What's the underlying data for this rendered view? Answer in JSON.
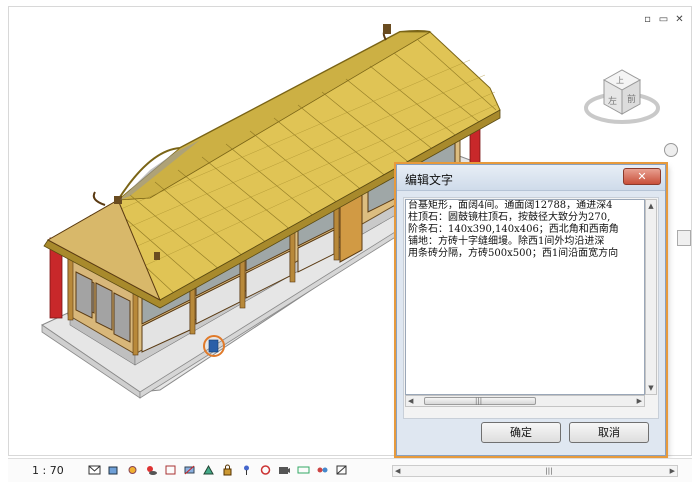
{
  "window_controls": {
    "minimize": "▫",
    "restore": "▭",
    "close": "✕"
  },
  "viewcube": {
    "top_face": "上",
    "left_face": "左",
    "right_face": "前"
  },
  "dialog": {
    "title": "编辑文字",
    "close_label": "✕",
    "text_lines": [
      "台基矩形，面阔4间。通面阔12788，通进深4",
      "柱顶石：圆鼓镜柱顶石，按鼓径大致分为270,",
      "阶条石：140x390,140x406；西北角和西南角",
      "铺地：方砖十字缝细墁。除西1间外均沿进深",
      "用条砖分隔，方砖500x500；西1间沿面宽方向"
    ],
    "ok_label": "确定",
    "cancel_label": "取消"
  },
  "bottom_bar": {
    "scale": "1 : 70",
    "icons": [
      "envelope-icon",
      "cube-icon",
      "sun-icon",
      "shadow-icon",
      "crop-icon",
      "hide-icon",
      "render-icon",
      "lock-icon",
      "pin-icon",
      "reveal-icon",
      "camera-icon",
      "link-icon",
      "workset-icon",
      "constraint-icon"
    ]
  },
  "colors": {
    "roof": "#e0c455",
    "roof_dark": "#b89a2f",
    "column_red": "#c8282a",
    "wood": "#c9a25a",
    "stone": "#e2e2e2",
    "dialog_highlight": "#e79a3c"
  }
}
